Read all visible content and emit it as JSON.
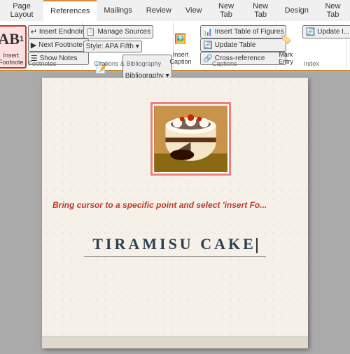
{
  "ribbon": {
    "tabs": [
      {
        "label": "Page Layout",
        "active": false
      },
      {
        "label": "References",
        "active": true
      },
      {
        "label": "Mailings",
        "active": false
      },
      {
        "label": "Review",
        "active": false
      },
      {
        "label": "View",
        "active": false
      },
      {
        "label": "New Tab",
        "active": false
      },
      {
        "label": "New Tab",
        "active": false
      },
      {
        "label": "Design",
        "active": false
      },
      {
        "label": "New Tab",
        "active": false
      }
    ],
    "groups": {
      "footnotes": {
        "label": "Footnotes",
        "insert_footnote": "Insert\nFootnote",
        "insert_endnote": "Insert Endnote",
        "next_footnote": "Next Footnote",
        "show_notes": "Show Notes"
      },
      "citations": {
        "label": "Citations & Bibliography",
        "manage_sources": "Manage Sources",
        "style": "Style: APA Fifth ▾",
        "insert_citation": "Insert\nCitation",
        "bibliography": "Bibliography ▾"
      },
      "captions": {
        "label": "Captions",
        "insert_caption": "Insert\nCaption",
        "insert_table_of_figures": "Insert Table of Figures",
        "update_table": "Update Table",
        "cross_reference": "Cross-reference"
      },
      "index": {
        "label": "Index",
        "mark_entry": "Mark\nEntry",
        "update_index": "Update I..."
      }
    }
  },
  "document": {
    "instruction": "Bring cursor to a specific point and select 'insert Fo...",
    "title": "TIRAMISU CAKE",
    "image_alt": "Tiramisu cake photograph"
  }
}
